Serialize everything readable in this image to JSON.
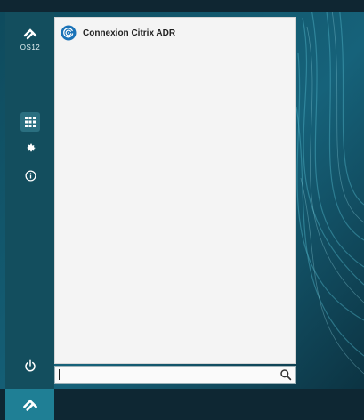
{
  "brand": {
    "logo_text": "OS12",
    "rail_color": "#134e5e",
    "accent_color": "#1f7f95",
    "panel_color": "#f4f4f4"
  },
  "rail": {
    "buttons": [
      {
        "name": "apps",
        "icon": "grid-icon",
        "selected": true
      },
      {
        "name": "settings",
        "icon": "gear-icon",
        "selected": false
      },
      {
        "name": "info",
        "icon": "info-icon",
        "selected": false
      },
      {
        "name": "power",
        "icon": "power-icon",
        "selected": false
      }
    ]
  },
  "menu": {
    "items": [
      {
        "label": "Connexion Citrix ADR",
        "icon": "citrix-app-icon"
      }
    ]
  },
  "search": {
    "value": "",
    "placeholder": "",
    "icon": "search-icon"
  },
  "taskbar": {
    "start_icon": "os12-logo-icon"
  }
}
